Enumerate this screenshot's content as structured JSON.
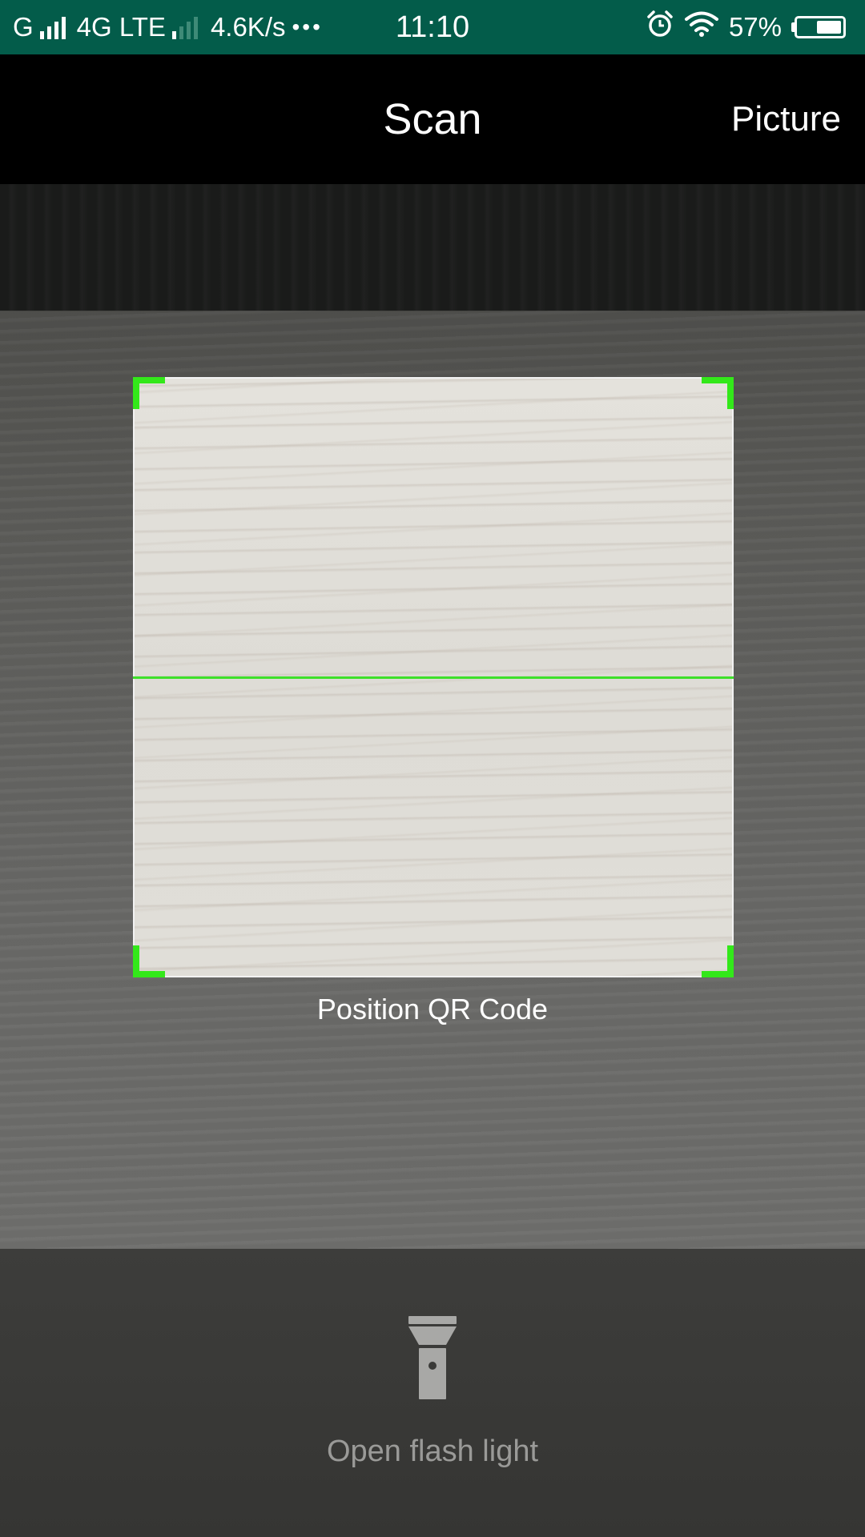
{
  "status_bar": {
    "carrier": "G",
    "network": "4G LTE",
    "speed": "4.6K/s",
    "more": "•••",
    "time": "11:10",
    "battery_percent": "57%",
    "battery_level": 0.57,
    "icons": [
      "signal-icon",
      "signal-icon",
      "alarm-icon",
      "wifi-icon",
      "battery-icon"
    ]
  },
  "app_bar": {
    "title": "Scan",
    "picture_label": "Picture"
  },
  "scanner": {
    "hint": "Position QR Code",
    "accent_color": "#33e81a"
  },
  "bottom": {
    "flash_label": "Open flash light",
    "flash_icon": "flashlight-icon"
  }
}
